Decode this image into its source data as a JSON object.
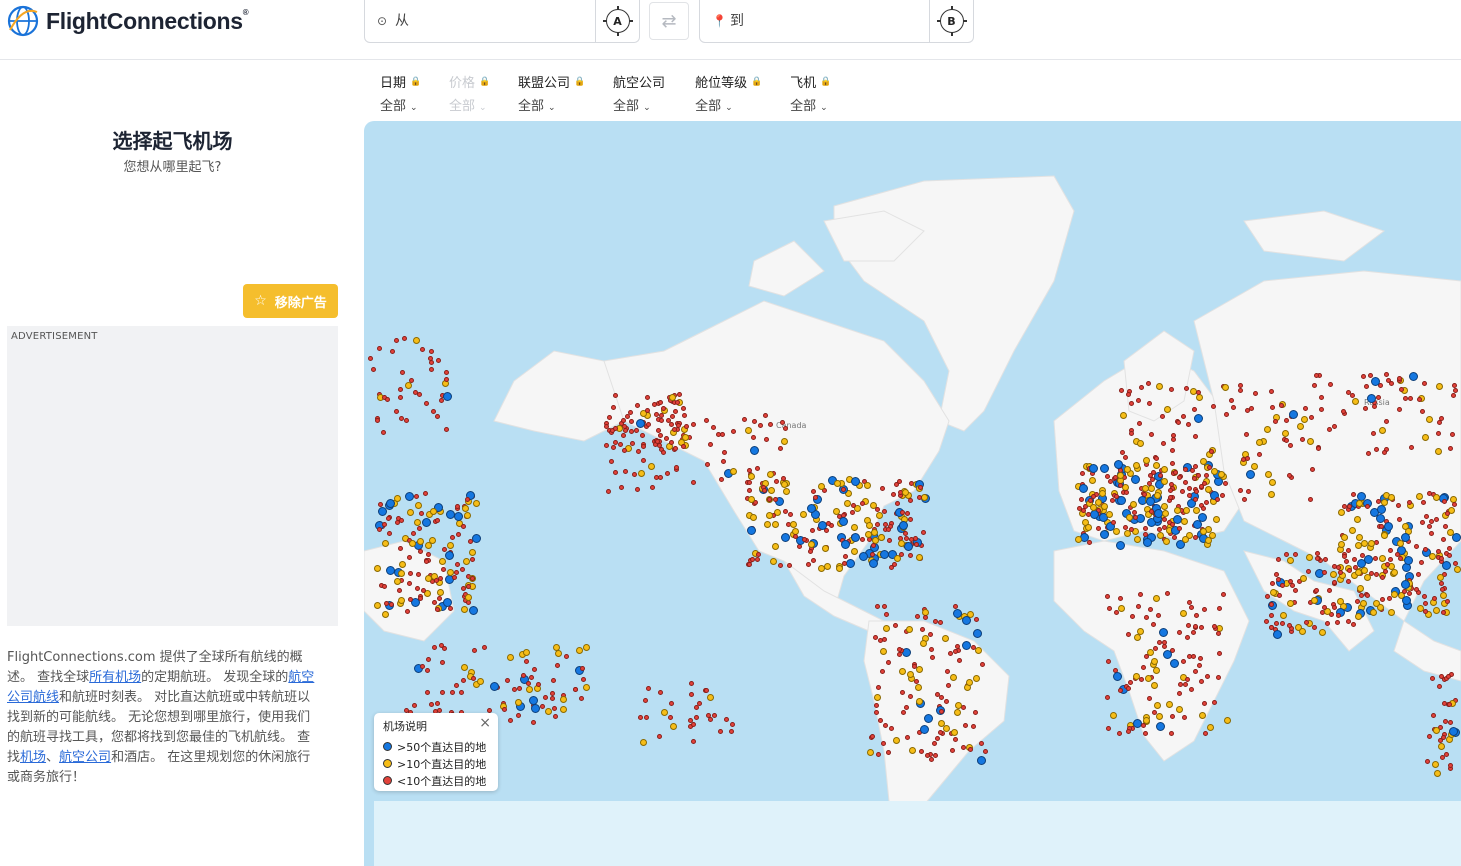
{
  "header": {
    "logo_text": "FlightConnections",
    "logo_mark": "®",
    "from": {
      "placeholder": "从",
      "locate_badge": "A"
    },
    "to": {
      "placeholder": "到",
      "locate_badge": "B"
    },
    "swap_icon": "swap-arrows-icon"
  },
  "filters": [
    {
      "label": "日期",
      "value": "全部",
      "locked": true,
      "disabled": false
    },
    {
      "label": "价格",
      "value": "全部",
      "locked": true,
      "disabled": true
    },
    {
      "label": "联盟公司",
      "value": "全部",
      "locked": true,
      "disabled": false
    },
    {
      "label": "航空公司",
      "value": "全部",
      "locked": false,
      "disabled": false
    },
    {
      "label": "舱位等级",
      "value": "全部",
      "locked": true,
      "disabled": false
    },
    {
      "label": "飞机",
      "value": "全部",
      "locked": true,
      "disabled": false
    }
  ],
  "sidebar": {
    "title": "选择起飞机场",
    "subtitle": "您想从哪里起飞?",
    "remove_ad": "移除广告",
    "ad_label": "ADVERTISEMENT",
    "desc": {
      "p1": "FlightConnections.com 提供了全球所有航线的概述。 查找全球",
      "link1": "所有机场",
      "p2": "的定期航班。 发现全球的",
      "link2": "航空公司航线",
      "p3": "和航班时刻表。 对比直达航班或中转航班以找到新的可能航线。 无论您想到哪里旅行，使用我们的航班寻找工具，您都将找到您最佳的飞机航线。 查找",
      "link3": "机场",
      "p4": "、",
      "link4": "航空公司",
      "p5": "和酒店。 在这里规划您的休闲旅行或商务旅行！"
    }
  },
  "map": {
    "labels": {
      "canada": "Canada",
      "russia": "Russia"
    },
    "colors": {
      "ocean": "#b9dff3",
      "land": "#f6f6f6",
      "blue": "#1577e0",
      "yellow": "#f6bd17",
      "red": "#e2423a"
    }
  },
  "legend": {
    "title": "机场说明",
    "items": [
      {
        "label": ">50个直达目的地",
        "color": "#1577e0"
      },
      {
        "label": ">10个直达目的地",
        "color": "#f6bd17"
      },
      {
        "label": "<10个直达目的地",
        "color": "#e2423a"
      }
    ]
  }
}
